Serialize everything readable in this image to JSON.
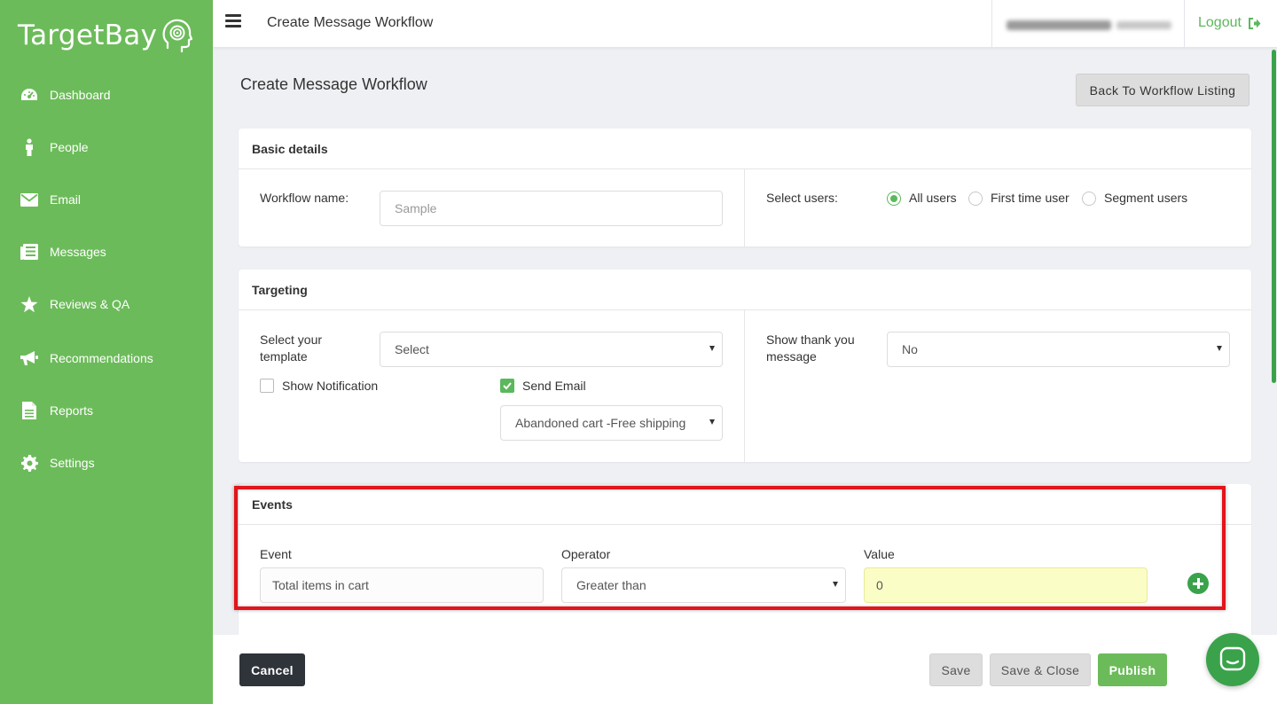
{
  "brand": {
    "name": "TargetBay",
    "color": "#6cbb5a",
    "accent": "#3aa24b"
  },
  "sidebar": {
    "items": [
      {
        "label": "Dashboard",
        "icon": "dashboard-icon"
      },
      {
        "label": "People",
        "icon": "person-icon"
      },
      {
        "label": "Email",
        "icon": "envelope-icon"
      },
      {
        "label": "Messages",
        "icon": "messages-icon"
      },
      {
        "label": "Reviews & QA",
        "icon": "star-icon"
      },
      {
        "label": "Recommendations",
        "icon": "megaphone-icon"
      },
      {
        "label": "Reports",
        "icon": "document-icon"
      },
      {
        "label": "Settings",
        "icon": "gear-icon"
      }
    ]
  },
  "topbar": {
    "title": "Create Message Workflow",
    "logout_label": "Logout"
  },
  "page": {
    "title": "Create Message Workflow",
    "back_button": "Back To Workflow Listing"
  },
  "basic_details": {
    "header": "Basic details",
    "workflow_name_label": "Workflow name:",
    "workflow_name_placeholder": "Sample",
    "select_users_label": "Select users:",
    "user_options": [
      {
        "label": "All users",
        "checked": true
      },
      {
        "label": "First time user",
        "checked": false
      },
      {
        "label": "Segment users",
        "checked": false
      }
    ]
  },
  "targeting": {
    "header": "Targeting",
    "template_label_line1": "Select your",
    "template_label_line2": "template",
    "template_value": "Select",
    "show_notification_label": "Show Notification",
    "show_notification_checked": false,
    "send_email_label": "Send Email",
    "send_email_checked": true,
    "email_template_value": "Abandoned cart -Free shipping",
    "thank_you_label_line1": "Show thank you",
    "thank_you_label_line2": "message",
    "thank_you_value": "No"
  },
  "events": {
    "header": "Events",
    "event_label": "Event",
    "event_value": "Total items in cart",
    "operator_label": "Operator",
    "operator_value": "Greater than",
    "value_label": "Value",
    "value_value": "0"
  },
  "footer": {
    "cancel": "Cancel",
    "save": "Save",
    "save_close": "Save & Close",
    "publish": "Publish"
  }
}
